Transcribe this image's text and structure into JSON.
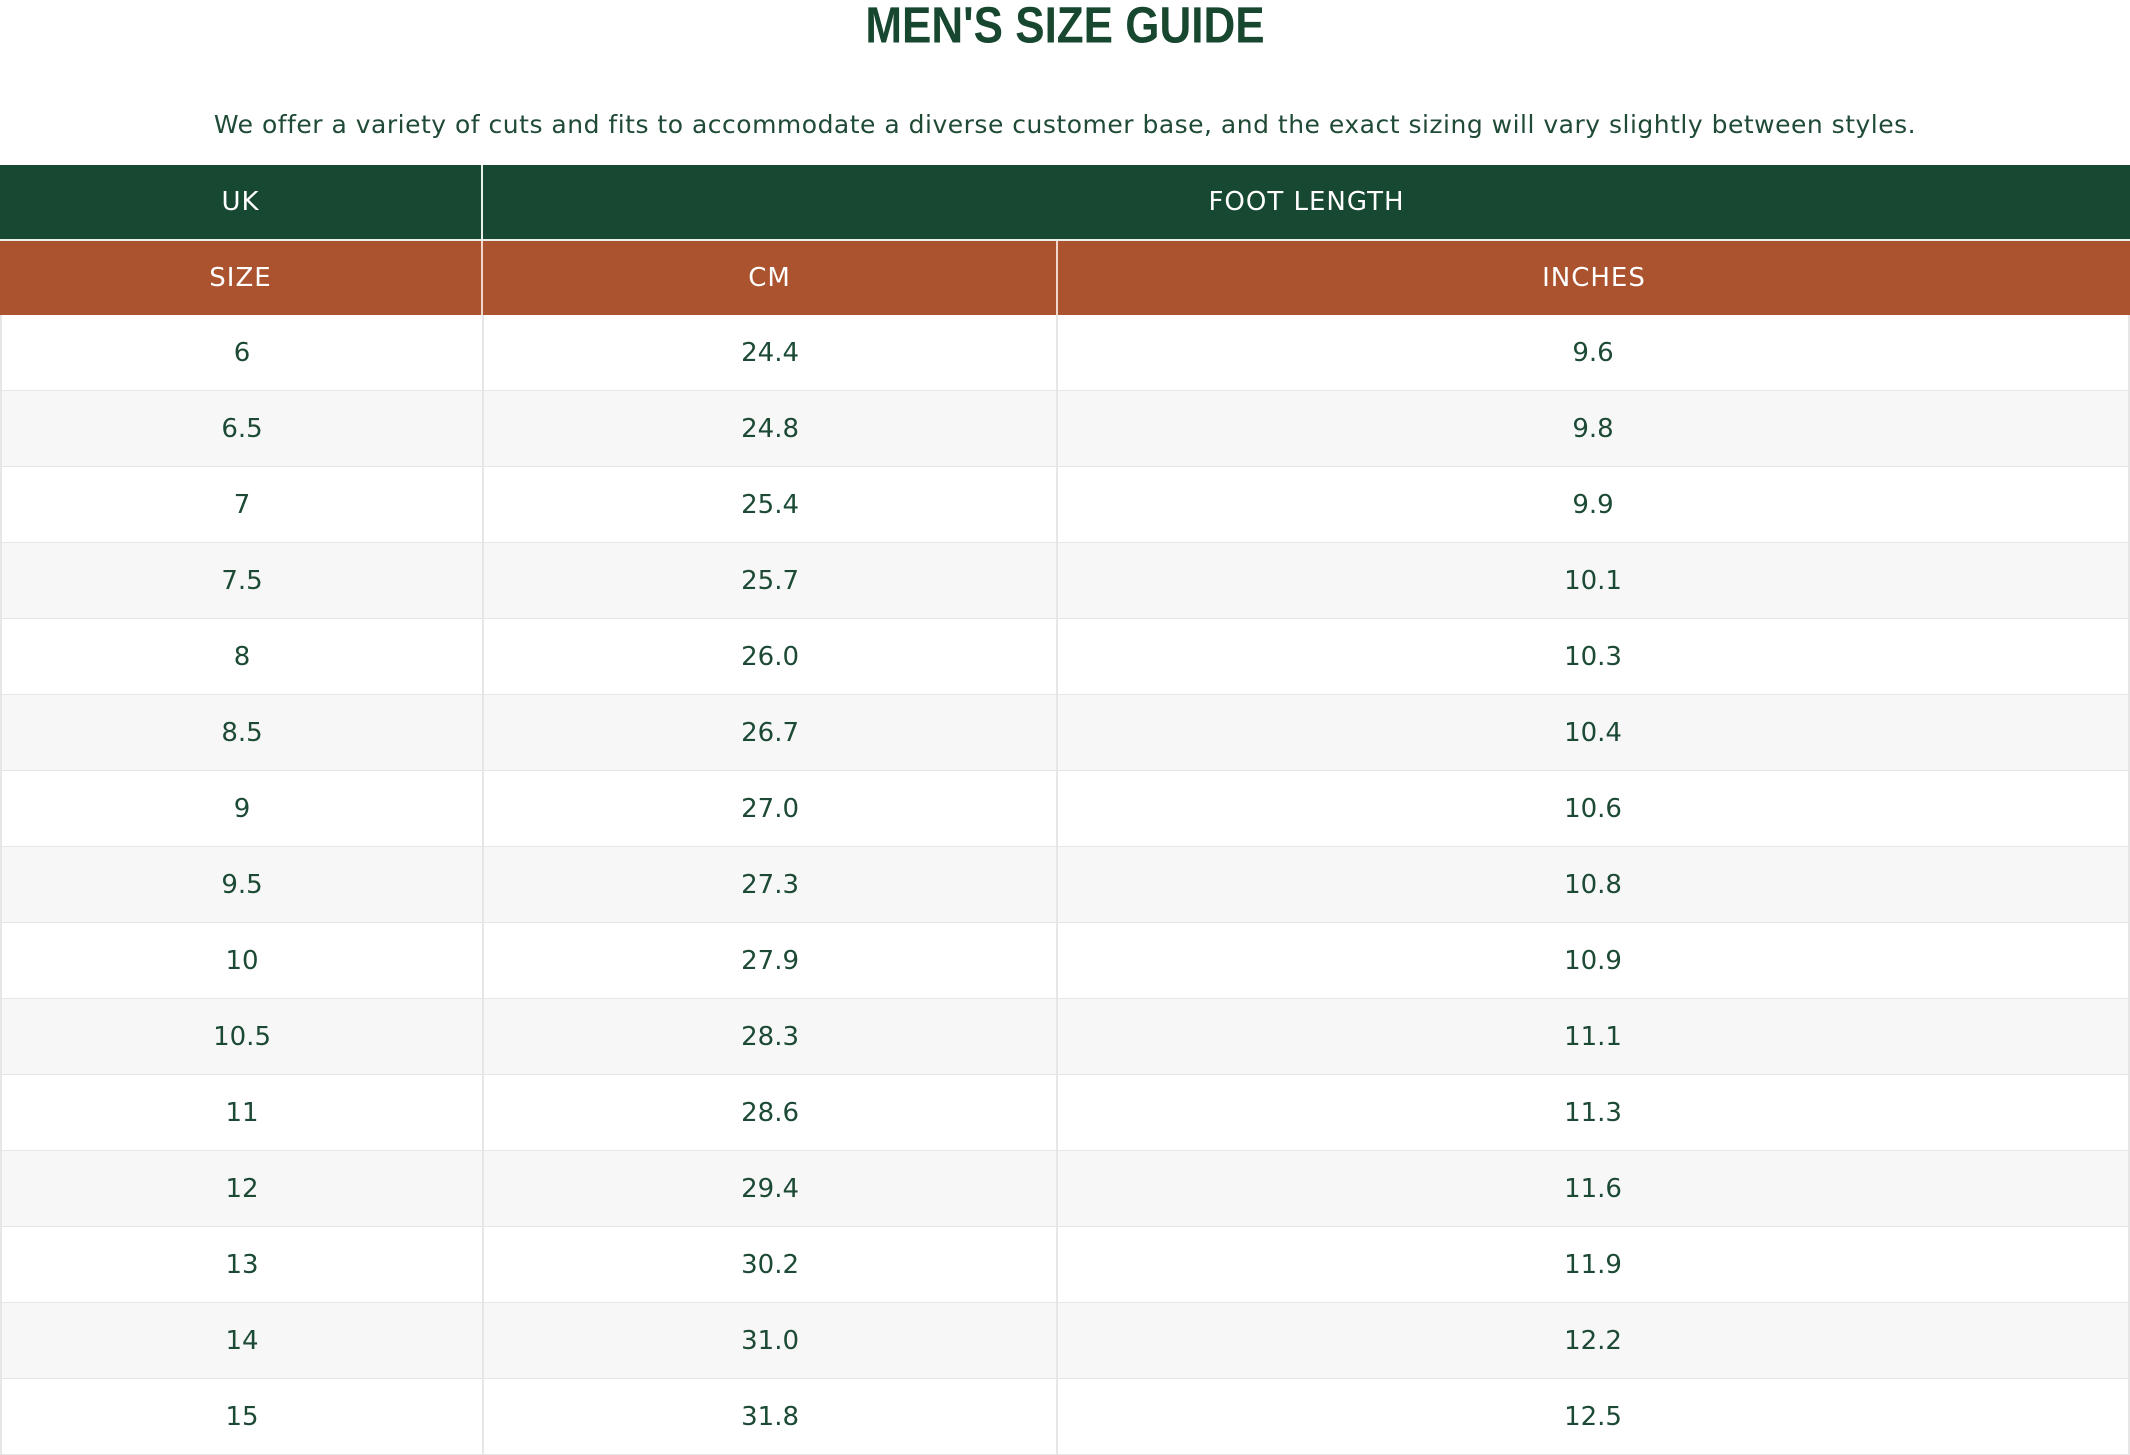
{
  "title": "MEN'S SIZE GUIDE",
  "subtitle": "We offer a variety of cuts and fits to accommodate a diverse customer base, and the exact sizing will vary slightly between styles.",
  "colors": {
    "header_green": "#174832",
    "header_rust": "#ab532e",
    "text_green": "#17472f",
    "row_alt": "#f7f7f7"
  },
  "table": {
    "group_headers": {
      "uk": "UK",
      "foot_length": "FOOT LENGTH"
    },
    "columns": {
      "size": "SIZE",
      "cm": "CM",
      "inches": "INCHES"
    },
    "rows": [
      {
        "size": "6",
        "cm": "24.4",
        "inches": "9.6"
      },
      {
        "size": "6.5",
        "cm": "24.8",
        "inches": "9.8"
      },
      {
        "size": "7",
        "cm": "25.4",
        "inches": "9.9"
      },
      {
        "size": "7.5",
        "cm": "25.7",
        "inches": "10.1"
      },
      {
        "size": "8",
        "cm": "26.0",
        "inches": "10.3"
      },
      {
        "size": "8.5",
        "cm": "26.7",
        "inches": "10.4"
      },
      {
        "size": "9",
        "cm": "27.0",
        "inches": "10.6"
      },
      {
        "size": "9.5",
        "cm": "27.3",
        "inches": "10.8"
      },
      {
        "size": "10",
        "cm": "27.9",
        "inches": "10.9"
      },
      {
        "size": "10.5",
        "cm": "28.3",
        "inches": "11.1"
      },
      {
        "size": "11",
        "cm": "28.6",
        "inches": "11.3"
      },
      {
        "size": "12",
        "cm": "29.4",
        "inches": "11.6"
      },
      {
        "size": "13",
        "cm": "30.2",
        "inches": "11.9"
      },
      {
        "size": "14",
        "cm": "31.0",
        "inches": "12.2"
      },
      {
        "size": "15",
        "cm": "31.8",
        "inches": "12.5"
      }
    ]
  }
}
